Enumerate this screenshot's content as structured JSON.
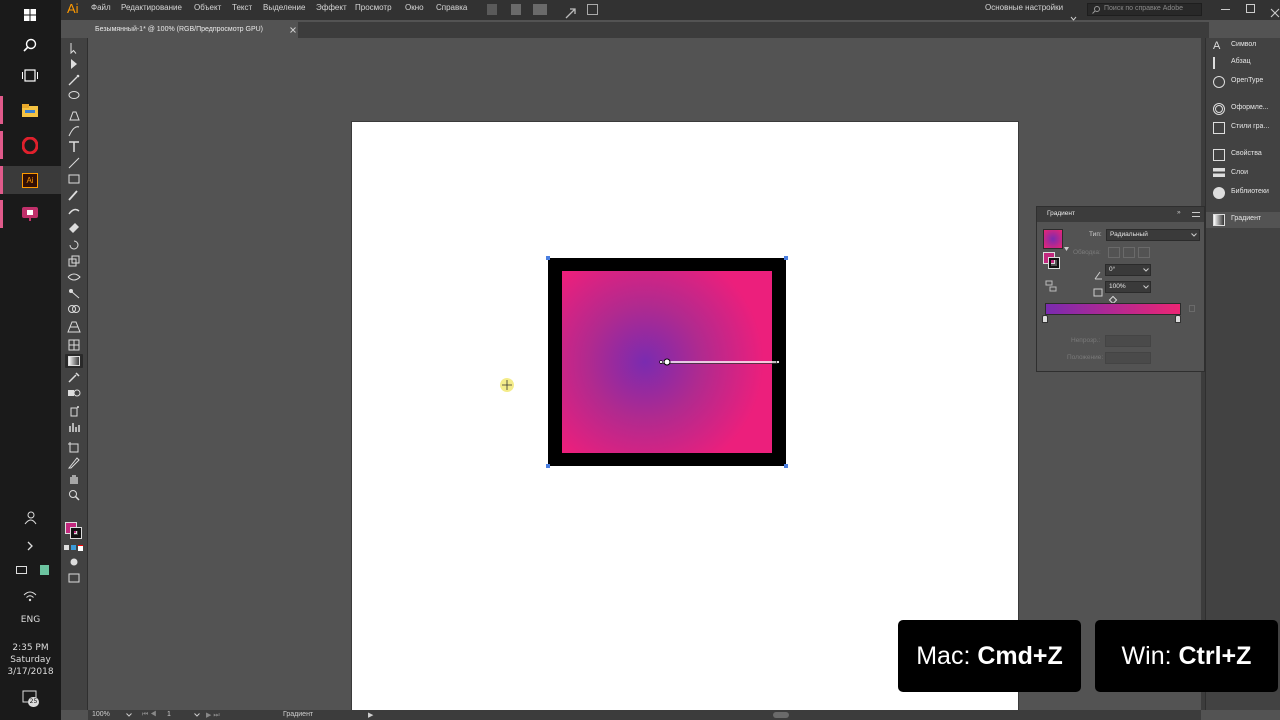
{
  "app": {
    "logo": "Ai",
    "menus": [
      "Файл",
      "Редактирование",
      "Объект",
      "Текст",
      "Выделение",
      "Эффект",
      "Просмотр",
      "Окно",
      "Справка"
    ],
    "workspace": "Основные настройки",
    "search_placeholder": "Поиск по справке Adobe"
  },
  "document": {
    "tab_title": "Безымянный-1* @ 100% (RGB/Предпросмотр GPU)"
  },
  "taskbar": {
    "language": "ENG",
    "time": "2:35 PM",
    "day": "Saturday",
    "date": "3/17/2018",
    "notification_count": "25",
    "apps": [
      "start-icon",
      "search-icon",
      "task-view-icon",
      "file-explorer-icon",
      "opera-icon",
      "illustrator-icon",
      "presentation-icon"
    ]
  },
  "panels": {
    "collapsed": [
      "Символ",
      "Абзац",
      "OpenType",
      "Оформле...",
      "Стили гра...",
      "Свойства",
      "Слои",
      "Библиотеки",
      "Градиент"
    ],
    "gradient": {
      "title": "Градиент",
      "type_label": "Тип:",
      "type_value": "Радиальный",
      "stroke_label": "Обводка:",
      "angle_value": "0°",
      "aspect_value": "100%",
      "opacity_label": "Непрозр.:",
      "location_label": "Положение:",
      "gradient_start": "#7a2bb0",
      "gradient_end": "#ec2574"
    }
  },
  "canvas": {
    "fill_center": "#7a2bb0",
    "fill_outer": "#ec1f7c",
    "stroke": "#000000"
  },
  "status": {
    "zoom": "100%",
    "artboard": "1",
    "tool": "Градиент"
  },
  "shortcuts": {
    "mac_prefix": "Mac: ",
    "mac_keys": "Cmd+Z",
    "win_prefix": "Win: ",
    "win_keys": "Ctrl+Z"
  }
}
